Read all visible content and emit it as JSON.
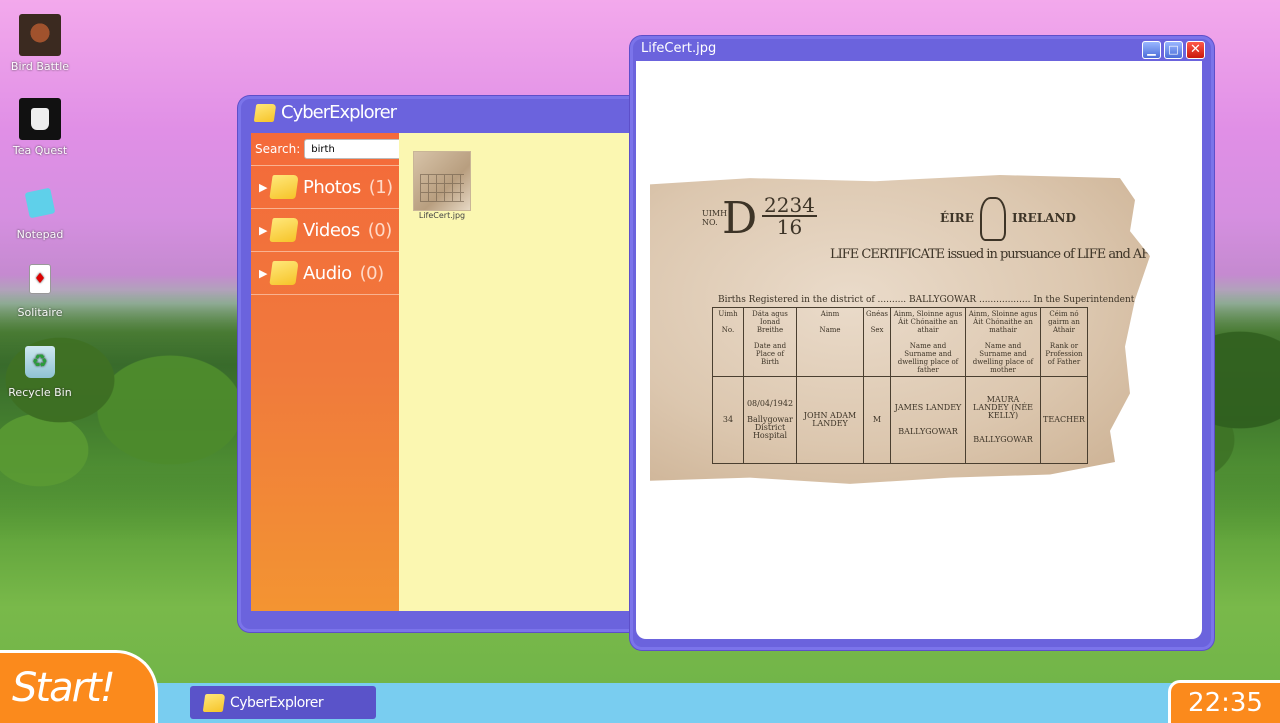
{
  "desktop": {
    "icons": [
      {
        "label": "Bird Battle",
        "icon": "bird-icon"
      },
      {
        "label": "Tea Quest",
        "icon": "teacup-icon"
      },
      {
        "label": "Notepad",
        "icon": "notepad-icon"
      },
      {
        "label": "Solitaire",
        "icon": "card-icon"
      },
      {
        "label": "Recycle Bin",
        "icon": "recycle-bin-icon"
      }
    ]
  },
  "explorer": {
    "title": "CyberExplorer",
    "search_label": "Search:",
    "search_value": "birth",
    "folders": [
      {
        "label": "Photos",
        "count": "(1)"
      },
      {
        "label": "Videos",
        "count": "(0)"
      },
      {
        "label": "Audio",
        "count": "(0)"
      }
    ],
    "files": [
      {
        "name": "LifeCert.jpg"
      }
    ]
  },
  "viewer": {
    "title": "LifeCert.jpg",
    "buttons": {
      "minimize": "▁",
      "maximize": "□",
      "close": "✕"
    },
    "certificate": {
      "no_label": "UIMH\nNO.",
      "big_letter": "D",
      "number_top": "2234",
      "number_bottom": "16",
      "eire": "ÉIRE",
      "ireland": "IRELAND",
      "heading": "LIFE CERTIFICATE issued in pursuance of LIFE and AFTERLIFE Registrat",
      "district_line": "Births Registered in the district of .......... BALLYGOWAR .................. In the Superintendent Registrar's Distr",
      "columns": [
        {
          "irish": "Uimh",
          "english": "No."
        },
        {
          "irish": "Dáta agus Ionad Breithe",
          "english": "Date and Place of Birth"
        },
        {
          "irish": "Ainm",
          "english": "Name"
        },
        {
          "irish": "Gnéas",
          "english": "Sex"
        },
        {
          "irish": "Ainm, Sloinne agus Áit Chónaithe an athair",
          "english": "Name and Surname and dwelling place of father"
        },
        {
          "irish": "Ainm, Sloinne agus Áit Chónaithe an mathair",
          "english": "Name and Surname and dwelling place of mother"
        },
        {
          "irish": "Céim nó gairm an Athair",
          "english": "Rank or Profession of Father"
        }
      ],
      "row": {
        "no": "34",
        "date": "08/04/1942",
        "place": "Ballygowar District Hospital",
        "name": "JOHN ADAM LANDEY",
        "sex": "M",
        "father": "JAMES LANDEY",
        "father_place": "BALLYGOWAR",
        "mother": "MAURA LANDEY (NÉE KELLY)",
        "mother_place": "BALLYGOWAR",
        "profession": "TEACHER"
      }
    }
  },
  "taskbar": {
    "start_label": "Start!",
    "items": [
      {
        "label": "CyberExplorer"
      }
    ],
    "clock": "22:35"
  },
  "colors": {
    "window_frame": "#6b63dd",
    "sidebar": "#f46a3a",
    "content_bg": "#fbf7b1",
    "taskbar": "#79cdf0",
    "start": "#fb8a1c"
  }
}
